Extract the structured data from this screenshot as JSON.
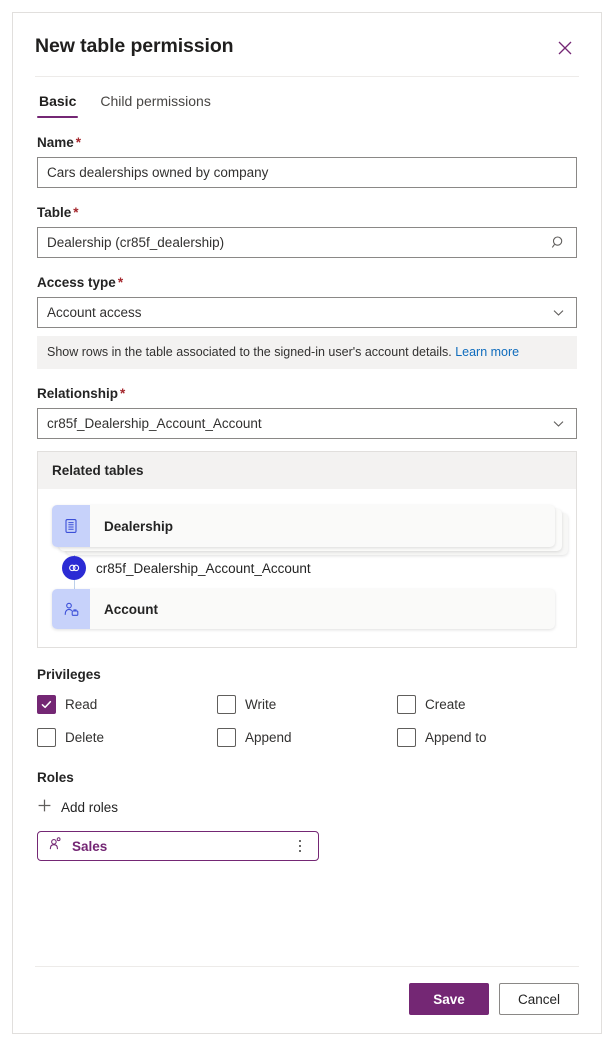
{
  "dialog": {
    "title": "New table permission",
    "close_icon": "close-icon"
  },
  "tabs": [
    {
      "label": "Basic",
      "active": true
    },
    {
      "label": "Child permissions",
      "active": false
    }
  ],
  "fields": {
    "name": {
      "label": "Name",
      "required": "*",
      "value": "Cars dealerships owned by company"
    },
    "table": {
      "label": "Table",
      "required": "*",
      "value": "Dealership (cr85f_dealership)",
      "trailing_icon": "search-icon"
    },
    "access_type": {
      "label": "Access type",
      "required": "*",
      "value": "Account access",
      "trailing_icon": "chevron-down-icon",
      "hint": "Show rows in the table associated to the signed-in user's account details.",
      "hint_link": "Learn more"
    },
    "relationship": {
      "label": "Relationship",
      "required": "*",
      "value": "cr85f_Dealership_Account_Account",
      "trailing_icon": "chevron-down-icon"
    }
  },
  "related_tables": {
    "header": "Related tables",
    "source_node": {
      "label": "Dealership",
      "icon": "table-icon"
    },
    "relationship_node": {
      "label": "cr85f_Dealership_Account_Account",
      "icon": "link-icon"
    },
    "target_node": {
      "label": "Account",
      "icon": "account-icon"
    }
  },
  "privileges": {
    "label": "Privileges",
    "items": [
      {
        "label": "Read",
        "checked": true
      },
      {
        "label": "Write",
        "checked": false
      },
      {
        "label": "Create",
        "checked": false
      },
      {
        "label": "Delete",
        "checked": false
      },
      {
        "label": "Append",
        "checked": false
      },
      {
        "label": "Append to",
        "checked": false
      }
    ]
  },
  "roles": {
    "label": "Roles",
    "add_label": "Add roles",
    "add_icon": "plus-icon",
    "chips": [
      {
        "label": "Sales",
        "icon": "person-icon",
        "more_icon": "more-vertical-icon"
      }
    ]
  },
  "footer": {
    "save_label": "Save",
    "cancel_label": "Cancel"
  },
  "colors": {
    "accent": "#742774",
    "link": "#0f6cbd",
    "required": "#a4262c",
    "node_icon_bg": "#c7d2fa",
    "relationship_badge": "#2b2bd4",
    "info_bar_bg": "#f3f2f1"
  }
}
